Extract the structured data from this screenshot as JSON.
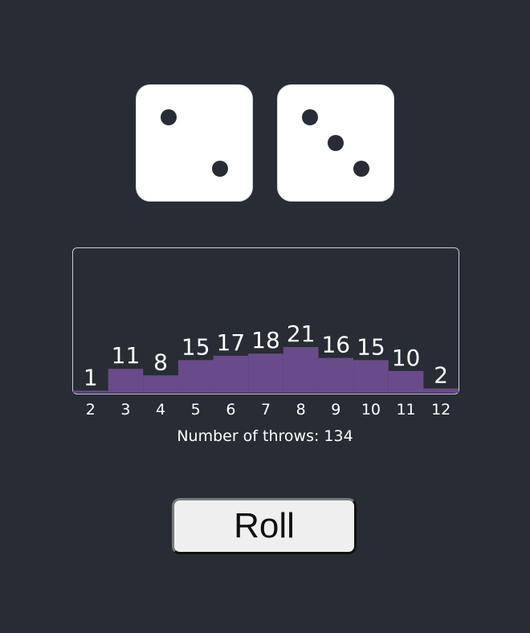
{
  "dice": [
    {
      "name": "die-left",
      "face": 2
    },
    {
      "name": "die-right",
      "face": 3
    }
  ],
  "chart_data": {
    "type": "bar",
    "categories": [
      "2",
      "3",
      "4",
      "5",
      "6",
      "7",
      "8",
      "9",
      "10",
      "11",
      "12"
    ],
    "values": [
      1,
      11,
      8,
      15,
      17,
      18,
      21,
      16,
      15,
      10,
      2
    ],
    "title": "",
    "xlabel": "",
    "ylabel": "",
    "bar_color": "#694b8b",
    "grid": false,
    "legend": "none"
  },
  "status": {
    "throws_text": "Number of throws: 134"
  },
  "controls": {
    "roll_label": "Roll"
  },
  "colors": {
    "background": "#282c35",
    "die_face": "#ffffff",
    "pip": "#282c35",
    "bar": "#694b8b"
  }
}
